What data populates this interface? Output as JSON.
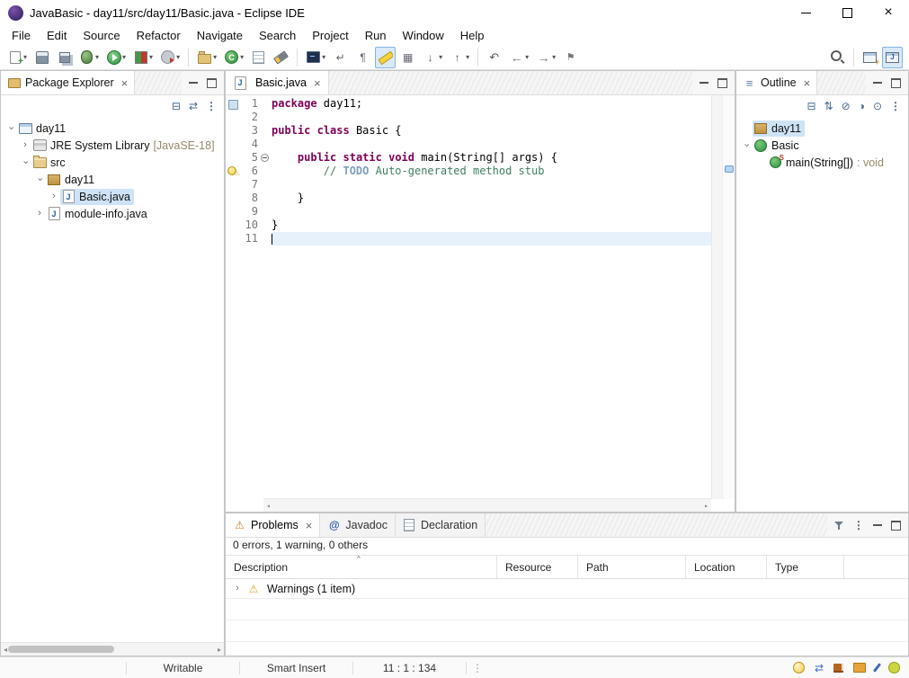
{
  "window": {
    "title": "JavaBasic - day11/src/day11/Basic.java - Eclipse IDE"
  },
  "menubar": {
    "items": [
      "File",
      "Edit",
      "Source",
      "Refactor",
      "Navigate",
      "Search",
      "Project",
      "Run",
      "Window",
      "Help"
    ]
  },
  "toolbar": {
    "buttons": [
      {
        "name": "new-wizard",
        "icon": "new-document",
        "dd": true
      },
      {
        "name": "save",
        "icon": "floppy"
      },
      {
        "name": "save-all",
        "icon": "floppy-all"
      },
      {
        "name": "debug",
        "icon": "debug-bug",
        "dd": true
      },
      {
        "name": "run",
        "icon": "run-play",
        "dd": true
      },
      {
        "name": "coverage",
        "icon": "coverage",
        "dd": true
      },
      {
        "name": "profile",
        "icon": "profile",
        "dd": true
      },
      {
        "sep": true
      },
      {
        "name": "new-java-project",
        "icon": "java-project",
        "dd": true
      },
      {
        "name": "new-java-class",
        "icon": "java-class",
        "dd": true
      },
      {
        "name": "open-task",
        "icon": "open-task"
      },
      {
        "name": "search-flashlight",
        "icon": "flashlight"
      },
      {
        "sep": true
      },
      {
        "name": "open-console",
        "icon": "console",
        "dd": true
      },
      {
        "name": "word-wrap",
        "icon": "word-wrap"
      },
      {
        "name": "show-whitespace",
        "icon": "pilcrow"
      },
      {
        "name": "mark-occurrences",
        "icon": "highlighter",
        "pressed": true
      },
      {
        "name": "block-selection",
        "icon": "block-select"
      },
      {
        "name": "next-annotation",
        "icon": "next-annotation",
        "dd": true
      },
      {
        "name": "previous-annotation",
        "icon": "prev-annotation",
        "dd": true
      },
      {
        "sep": true
      },
      {
        "name": "last-edit-location",
        "icon": "last-edit"
      },
      {
        "name": "back",
        "icon": "back",
        "dd": true
      },
      {
        "name": "forward",
        "icon": "forward",
        "dd": true
      },
      {
        "name": "pin-editor",
        "icon": "pin"
      }
    ]
  },
  "package_explorer": {
    "tab": "Package Explorer",
    "tree": [
      {
        "label": "day11",
        "icon": "project",
        "depth": 0,
        "exp": "open"
      },
      {
        "label": "JRE System Library",
        "suffix": "[JavaSE-18]",
        "icon": "library",
        "depth": 1,
        "exp": "closed"
      },
      {
        "label": "src",
        "icon": "src-folder",
        "depth": 1,
        "exp": "open"
      },
      {
        "label": "day11",
        "icon": "package",
        "depth": 2,
        "exp": "open"
      },
      {
        "label": "Basic.java",
        "icon": "java-file",
        "depth": 3,
        "exp": "closed",
        "selected": true
      },
      {
        "label": "module-info.java",
        "icon": "java-file",
        "depth": 2,
        "exp": "closed"
      }
    ]
  },
  "editor": {
    "tab": "Basic.java",
    "code": [
      {
        "num": "1",
        "marker": "mark",
        "segs": [
          [
            "kw",
            "package"
          ],
          [
            "pl",
            " day11;"
          ]
        ]
      },
      {
        "num": "2",
        "segs": []
      },
      {
        "num": "3",
        "segs": [
          [
            "kw",
            "public"
          ],
          [
            "pl",
            " "
          ],
          [
            "kw",
            "class"
          ],
          [
            "pl",
            " Basic {"
          ]
        ]
      },
      {
        "num": "4",
        "segs": []
      },
      {
        "num": "5",
        "fold": "collapse",
        "segs": [
          [
            "pl",
            "    "
          ],
          [
            "kw",
            "public"
          ],
          [
            "pl",
            " "
          ],
          [
            "kw",
            "static"
          ],
          [
            "pl",
            " "
          ],
          [
            "kw",
            "void"
          ],
          [
            "pl",
            " main(String[] args) {"
          ]
        ]
      },
      {
        "num": "6",
        "marker": "bulb",
        "segs": [
          [
            "pl",
            "        "
          ],
          [
            "cm",
            "// "
          ],
          [
            "todo",
            "TODO"
          ],
          [
            "cm",
            " Auto-generated method stub"
          ]
        ]
      },
      {
        "num": "7",
        "segs": []
      },
      {
        "num": "8",
        "segs": [
          [
            "pl",
            "    }"
          ]
        ]
      },
      {
        "num": "9",
        "segs": []
      },
      {
        "num": "10",
        "segs": [
          [
            "pl",
            "}"
          ]
        ]
      },
      {
        "num": "11",
        "cur": true,
        "segs": []
      }
    ]
  },
  "outline": {
    "tab": "Outline",
    "tree": [
      {
        "label": "day11",
        "icon": "package",
        "depth": 0,
        "selected": true
      },
      {
        "label": "Basic",
        "icon": "class",
        "depth": 0,
        "exp": "open"
      },
      {
        "label": "main(String[])",
        "suffix": ": void",
        "icon": "method-static",
        "depth": 1
      }
    ]
  },
  "problems": {
    "tabs": [
      {
        "label": "Problems",
        "icon": "problems",
        "active": true,
        "closable": true
      },
      {
        "label": "Javadoc",
        "icon": "javadoc"
      },
      {
        "label": "Declaration",
        "icon": "declaration"
      }
    ],
    "summary": "0 errors, 1 warning, 0 others",
    "columns": [
      "Description",
      "Resource",
      "Path",
      "Location",
      "Type"
    ],
    "group_row": "Warnings (1 item)",
    "empty_row_count": 3
  },
  "statusbar": {
    "writable": "Writable",
    "insert_mode": "Smart Insert",
    "position": "11 : 1 : 134"
  }
}
